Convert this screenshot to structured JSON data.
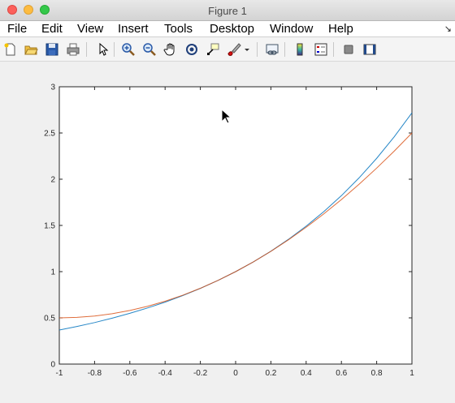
{
  "window": {
    "title": "Figure 1"
  },
  "menu": [
    {
      "label": "File"
    },
    {
      "label": "Edit"
    },
    {
      "label": "View"
    },
    {
      "label": "Insert"
    },
    {
      "label": "Tools"
    },
    {
      "label": "Desktop"
    },
    {
      "label": "Window"
    },
    {
      "label": "Help"
    }
  ],
  "toolbar": {
    "icons": [
      "new-figure-icon",
      "open-file-icon",
      "save-icon",
      "print-icon",
      "edit-plot-arrow-icon",
      "zoom-in-icon",
      "zoom-out-icon",
      "pan-hand-icon",
      "rotate-3d-icon",
      "data-cursor-icon",
      "brush-icon",
      "brush-dropdown-icon",
      "link-plot-icon",
      "insert-colorbar-icon",
      "insert-legend-icon",
      "hide-plot-tools-icon",
      "show-plot-tools-icon"
    ]
  },
  "colors": {
    "series1": "#0072bd",
    "series2": "#d95319",
    "axes_bg": "#ffffff",
    "figure_bg": "#f0f0f0"
  },
  "chart_data": {
    "type": "line",
    "title": "",
    "xlabel": "",
    "ylabel": "",
    "xlim": [
      -1,
      1
    ],
    "ylim": [
      0,
      3
    ],
    "grid": false,
    "legend": "none",
    "xticks": [
      "-1",
      "-0.8",
      "-0.6",
      "-0.4",
      "-0.2",
      "0",
      "0.2",
      "0.4",
      "0.6",
      "0.8",
      "1"
    ],
    "yticks": [
      "0",
      "0.5",
      "1",
      "1.5",
      "2",
      "2.5",
      "3"
    ],
    "series": [
      {
        "x": [
          -1,
          -0.9,
          -0.8,
          -0.7,
          -0.6,
          -0.5,
          -0.4,
          -0.3,
          -0.2,
          -0.1,
          0,
          0.1,
          0.2,
          0.3,
          0.4,
          0.5,
          0.6,
          0.7,
          0.8,
          0.9,
          1
        ],
        "y": [
          0.368,
          0.407,
          0.449,
          0.497,
          0.549,
          0.607,
          0.67,
          0.741,
          0.819,
          0.905,
          1.0,
          1.105,
          1.221,
          1.35,
          1.492,
          1.649,
          1.822,
          2.014,
          2.226,
          2.46,
          2.718
        ]
      },
      {
        "x": [
          -1,
          -0.9,
          -0.8,
          -0.7,
          -0.6,
          -0.5,
          -0.4,
          -0.3,
          -0.2,
          -0.1,
          0,
          0.1,
          0.2,
          0.3,
          0.4,
          0.5,
          0.6,
          0.7,
          0.8,
          0.9,
          1
        ],
        "y": [
          0.5,
          0.505,
          0.52,
          0.545,
          0.58,
          0.625,
          0.68,
          0.745,
          0.82,
          0.905,
          1.0,
          1.105,
          1.22,
          1.345,
          1.48,
          1.625,
          1.78,
          1.945,
          2.12,
          2.305,
          2.5
        ]
      }
    ]
  }
}
